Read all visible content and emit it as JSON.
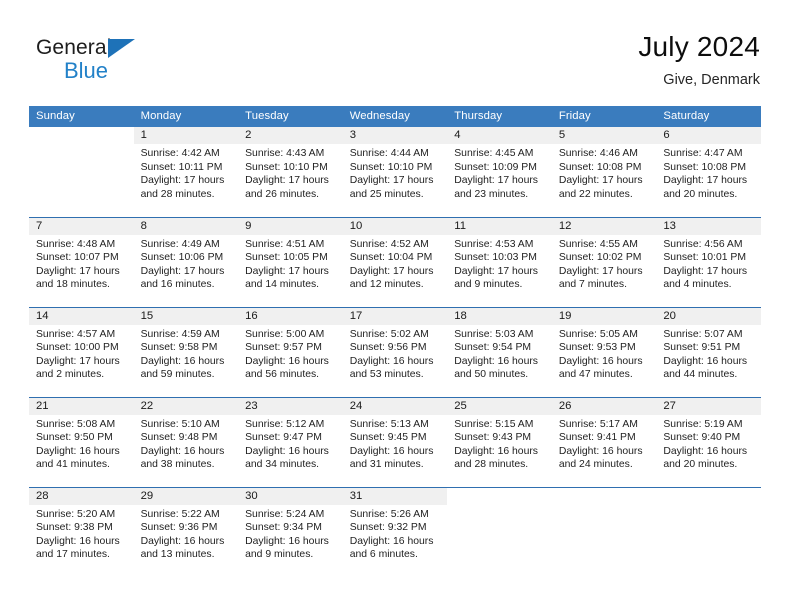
{
  "brand": {
    "word_one": "General",
    "word_two": "Blue",
    "accent_color": "#2281c8"
  },
  "header": {
    "title": "July 2024",
    "subtitle": "Give, Denmark"
  },
  "calendar": {
    "header_bg": "#3a7cbe",
    "weekday_headers": [
      "Sunday",
      "Monday",
      "Tuesday",
      "Wednesday",
      "Thursday",
      "Friday",
      "Saturday"
    ],
    "weeks": [
      [
        {
          "day": "",
          "sunrise": "",
          "sunset": "",
          "daylight_1": "",
          "daylight_2": "",
          "blank": true
        },
        {
          "day": "1",
          "sunrise": "Sunrise: 4:42 AM",
          "sunset": "Sunset: 10:11 PM",
          "daylight_1": "Daylight: 17 hours",
          "daylight_2": "and 28 minutes."
        },
        {
          "day": "2",
          "sunrise": "Sunrise: 4:43 AM",
          "sunset": "Sunset: 10:10 PM",
          "daylight_1": "Daylight: 17 hours",
          "daylight_2": "and 26 minutes."
        },
        {
          "day": "3",
          "sunrise": "Sunrise: 4:44 AM",
          "sunset": "Sunset: 10:10 PM",
          "daylight_1": "Daylight: 17 hours",
          "daylight_2": "and 25 minutes."
        },
        {
          "day": "4",
          "sunrise": "Sunrise: 4:45 AM",
          "sunset": "Sunset: 10:09 PM",
          "daylight_1": "Daylight: 17 hours",
          "daylight_2": "and 23 minutes."
        },
        {
          "day": "5",
          "sunrise": "Sunrise: 4:46 AM",
          "sunset": "Sunset: 10:08 PM",
          "daylight_1": "Daylight: 17 hours",
          "daylight_2": "and 22 minutes."
        },
        {
          "day": "6",
          "sunrise": "Sunrise: 4:47 AM",
          "sunset": "Sunset: 10:08 PM",
          "daylight_1": "Daylight: 17 hours",
          "daylight_2": "and 20 minutes."
        }
      ],
      [
        {
          "day": "7",
          "sunrise": "Sunrise: 4:48 AM",
          "sunset": "Sunset: 10:07 PM",
          "daylight_1": "Daylight: 17 hours",
          "daylight_2": "and 18 minutes."
        },
        {
          "day": "8",
          "sunrise": "Sunrise: 4:49 AM",
          "sunset": "Sunset: 10:06 PM",
          "daylight_1": "Daylight: 17 hours",
          "daylight_2": "and 16 minutes."
        },
        {
          "day": "9",
          "sunrise": "Sunrise: 4:51 AM",
          "sunset": "Sunset: 10:05 PM",
          "daylight_1": "Daylight: 17 hours",
          "daylight_2": "and 14 minutes."
        },
        {
          "day": "10",
          "sunrise": "Sunrise: 4:52 AM",
          "sunset": "Sunset: 10:04 PM",
          "daylight_1": "Daylight: 17 hours",
          "daylight_2": "and 12 minutes."
        },
        {
          "day": "11",
          "sunrise": "Sunrise: 4:53 AM",
          "sunset": "Sunset: 10:03 PM",
          "daylight_1": "Daylight: 17 hours",
          "daylight_2": "and 9 minutes."
        },
        {
          "day": "12",
          "sunrise": "Sunrise: 4:55 AM",
          "sunset": "Sunset: 10:02 PM",
          "daylight_1": "Daylight: 17 hours",
          "daylight_2": "and 7 minutes."
        },
        {
          "day": "13",
          "sunrise": "Sunrise: 4:56 AM",
          "sunset": "Sunset: 10:01 PM",
          "daylight_1": "Daylight: 17 hours",
          "daylight_2": "and 4 minutes."
        }
      ],
      [
        {
          "day": "14",
          "sunrise": "Sunrise: 4:57 AM",
          "sunset": "Sunset: 10:00 PM",
          "daylight_1": "Daylight: 17 hours",
          "daylight_2": "and 2 minutes."
        },
        {
          "day": "15",
          "sunrise": "Sunrise: 4:59 AM",
          "sunset": "Sunset: 9:58 PM",
          "daylight_1": "Daylight: 16 hours",
          "daylight_2": "and 59 minutes."
        },
        {
          "day": "16",
          "sunrise": "Sunrise: 5:00 AM",
          "sunset": "Sunset: 9:57 PM",
          "daylight_1": "Daylight: 16 hours",
          "daylight_2": "and 56 minutes."
        },
        {
          "day": "17",
          "sunrise": "Sunrise: 5:02 AM",
          "sunset": "Sunset: 9:56 PM",
          "daylight_1": "Daylight: 16 hours",
          "daylight_2": "and 53 minutes."
        },
        {
          "day": "18",
          "sunrise": "Sunrise: 5:03 AM",
          "sunset": "Sunset: 9:54 PM",
          "daylight_1": "Daylight: 16 hours",
          "daylight_2": "and 50 minutes."
        },
        {
          "day": "19",
          "sunrise": "Sunrise: 5:05 AM",
          "sunset": "Sunset: 9:53 PM",
          "daylight_1": "Daylight: 16 hours",
          "daylight_2": "and 47 minutes."
        },
        {
          "day": "20",
          "sunrise": "Sunrise: 5:07 AM",
          "sunset": "Sunset: 9:51 PM",
          "daylight_1": "Daylight: 16 hours",
          "daylight_2": "and 44 minutes."
        }
      ],
      [
        {
          "day": "21",
          "sunrise": "Sunrise: 5:08 AM",
          "sunset": "Sunset: 9:50 PM",
          "daylight_1": "Daylight: 16 hours",
          "daylight_2": "and 41 minutes."
        },
        {
          "day": "22",
          "sunrise": "Sunrise: 5:10 AM",
          "sunset": "Sunset: 9:48 PM",
          "daylight_1": "Daylight: 16 hours",
          "daylight_2": "and 38 minutes."
        },
        {
          "day": "23",
          "sunrise": "Sunrise: 5:12 AM",
          "sunset": "Sunset: 9:47 PM",
          "daylight_1": "Daylight: 16 hours",
          "daylight_2": "and 34 minutes."
        },
        {
          "day": "24",
          "sunrise": "Sunrise: 5:13 AM",
          "sunset": "Sunset: 9:45 PM",
          "daylight_1": "Daylight: 16 hours",
          "daylight_2": "and 31 minutes."
        },
        {
          "day": "25",
          "sunrise": "Sunrise: 5:15 AM",
          "sunset": "Sunset: 9:43 PM",
          "daylight_1": "Daylight: 16 hours",
          "daylight_2": "and 28 minutes."
        },
        {
          "day": "26",
          "sunrise": "Sunrise: 5:17 AM",
          "sunset": "Sunset: 9:41 PM",
          "daylight_1": "Daylight: 16 hours",
          "daylight_2": "and 24 minutes."
        },
        {
          "day": "27",
          "sunrise": "Sunrise: 5:19 AM",
          "sunset": "Sunset: 9:40 PM",
          "daylight_1": "Daylight: 16 hours",
          "daylight_2": "and 20 minutes."
        }
      ],
      [
        {
          "day": "28",
          "sunrise": "Sunrise: 5:20 AM",
          "sunset": "Sunset: 9:38 PM",
          "daylight_1": "Daylight: 16 hours",
          "daylight_2": "and 17 minutes."
        },
        {
          "day": "29",
          "sunrise": "Sunrise: 5:22 AM",
          "sunset": "Sunset: 9:36 PM",
          "daylight_1": "Daylight: 16 hours",
          "daylight_2": "and 13 minutes."
        },
        {
          "day": "30",
          "sunrise": "Sunrise: 5:24 AM",
          "sunset": "Sunset: 9:34 PM",
          "daylight_1": "Daylight: 16 hours",
          "daylight_2": "and 9 minutes."
        },
        {
          "day": "31",
          "sunrise": "Sunrise: 5:26 AM",
          "sunset": "Sunset: 9:32 PM",
          "daylight_1": "Daylight: 16 hours",
          "daylight_2": "and 6 minutes."
        },
        {
          "day": "",
          "sunrise": "",
          "sunset": "",
          "daylight_1": "",
          "daylight_2": "",
          "blank": true
        },
        {
          "day": "",
          "sunrise": "",
          "sunset": "",
          "daylight_1": "",
          "daylight_2": "",
          "blank": true
        },
        {
          "day": "",
          "sunrise": "",
          "sunset": "",
          "daylight_1": "",
          "daylight_2": "",
          "blank": true
        }
      ]
    ]
  }
}
